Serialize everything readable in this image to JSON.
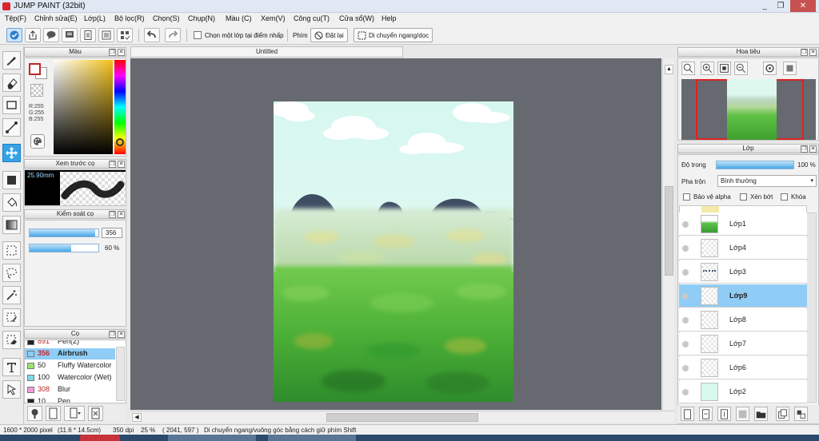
{
  "window": {
    "title": "JUMP PAINT (32bit)",
    "controls": [
      "_",
      "❐",
      "✕"
    ]
  },
  "menu": [
    "Tệp(F)",
    "Chỉnh sửa(E)",
    "Lớp(L)",
    "Bộ lọc(R)",
    "Chọn(S)",
    "Chụp(N)",
    "Màu (C)",
    "Xem(V)",
    "Công cụ(T)",
    "Cửa sổ(W)",
    "Help"
  ],
  "toolbar": {
    "select_one_layer_label": "Chọn một lớp tại điểm nhấp",
    "keys_label": "Phím",
    "reset_label": "Đặt lại",
    "move_label": "Di chuyển ngang/dọc"
  },
  "color_panel": {
    "title": "Màu",
    "r": "R:255",
    "g": "G:255",
    "b": "B:255",
    "foreground": "#ffffff",
    "background": "#ffffff"
  },
  "brush_preview": {
    "title": "Xem trước cọ",
    "size_label": "25.90mm"
  },
  "brush_control": {
    "title": "Kiểm soát cọ",
    "size_value": "356",
    "opacity_value": "60 %",
    "opacity_fraction": 0.6,
    "size_fraction": 0.95
  },
  "brushes": {
    "title": "Cọ",
    "items": [
      {
        "size": "891",
        "name": "Pen(2)",
        "color": "#222222"
      },
      {
        "size": "356",
        "name": "Airbrush",
        "color": "#ffffff",
        "active": true
      },
      {
        "size": "50",
        "name": "Fluffy Watercolor",
        "color": "#9ee36f"
      },
      {
        "size": "100",
        "name": "Watercolor (Wet)",
        "color": "#7fd9ec"
      },
      {
        "size": "308",
        "name": "Blur",
        "color": "#f39ad9"
      },
      {
        "size": "10",
        "name": "Pen",
        "color": "#222222"
      }
    ]
  },
  "document": {
    "tab_title": "Untitled"
  },
  "navigator": {
    "title": "Hoa tiêu"
  },
  "layers_panel": {
    "title": "Lớp",
    "opacity_label": "Độ trong",
    "opacity_value": "100 %",
    "opacity_fraction": 1.0,
    "blend_label": "Pha trộn",
    "blend_value": "Bình thường",
    "protect_alpha": "Bảo vệ alpha",
    "clip": "Xén bớt",
    "lock": "Khóa",
    "layers": [
      {
        "name": "Lớp1",
        "thumb": "grass"
      },
      {
        "name": "Lớp4",
        "thumb": "empty"
      },
      {
        "name": "Lớp3",
        "thumb": "dash"
      },
      {
        "name": "Lớp9",
        "thumb": "empty",
        "active": true
      },
      {
        "name": "Lớp8",
        "thumb": "empty"
      },
      {
        "name": "Lớp7",
        "thumb": "empty"
      },
      {
        "name": "Lớp6",
        "thumb": "empty"
      },
      {
        "name": "Lớp2",
        "thumb": "sky"
      }
    ]
  },
  "status": {
    "size": "1600 * 2000 pixel",
    "physical": "(11.6 * 14.5cm)",
    "dpi": "350 dpi",
    "zoom": "25 %",
    "coords": "( 2041, 597 )",
    "hint": "Di chuyển ngang/vuông góc bằng cách giữ phím Shift"
  }
}
